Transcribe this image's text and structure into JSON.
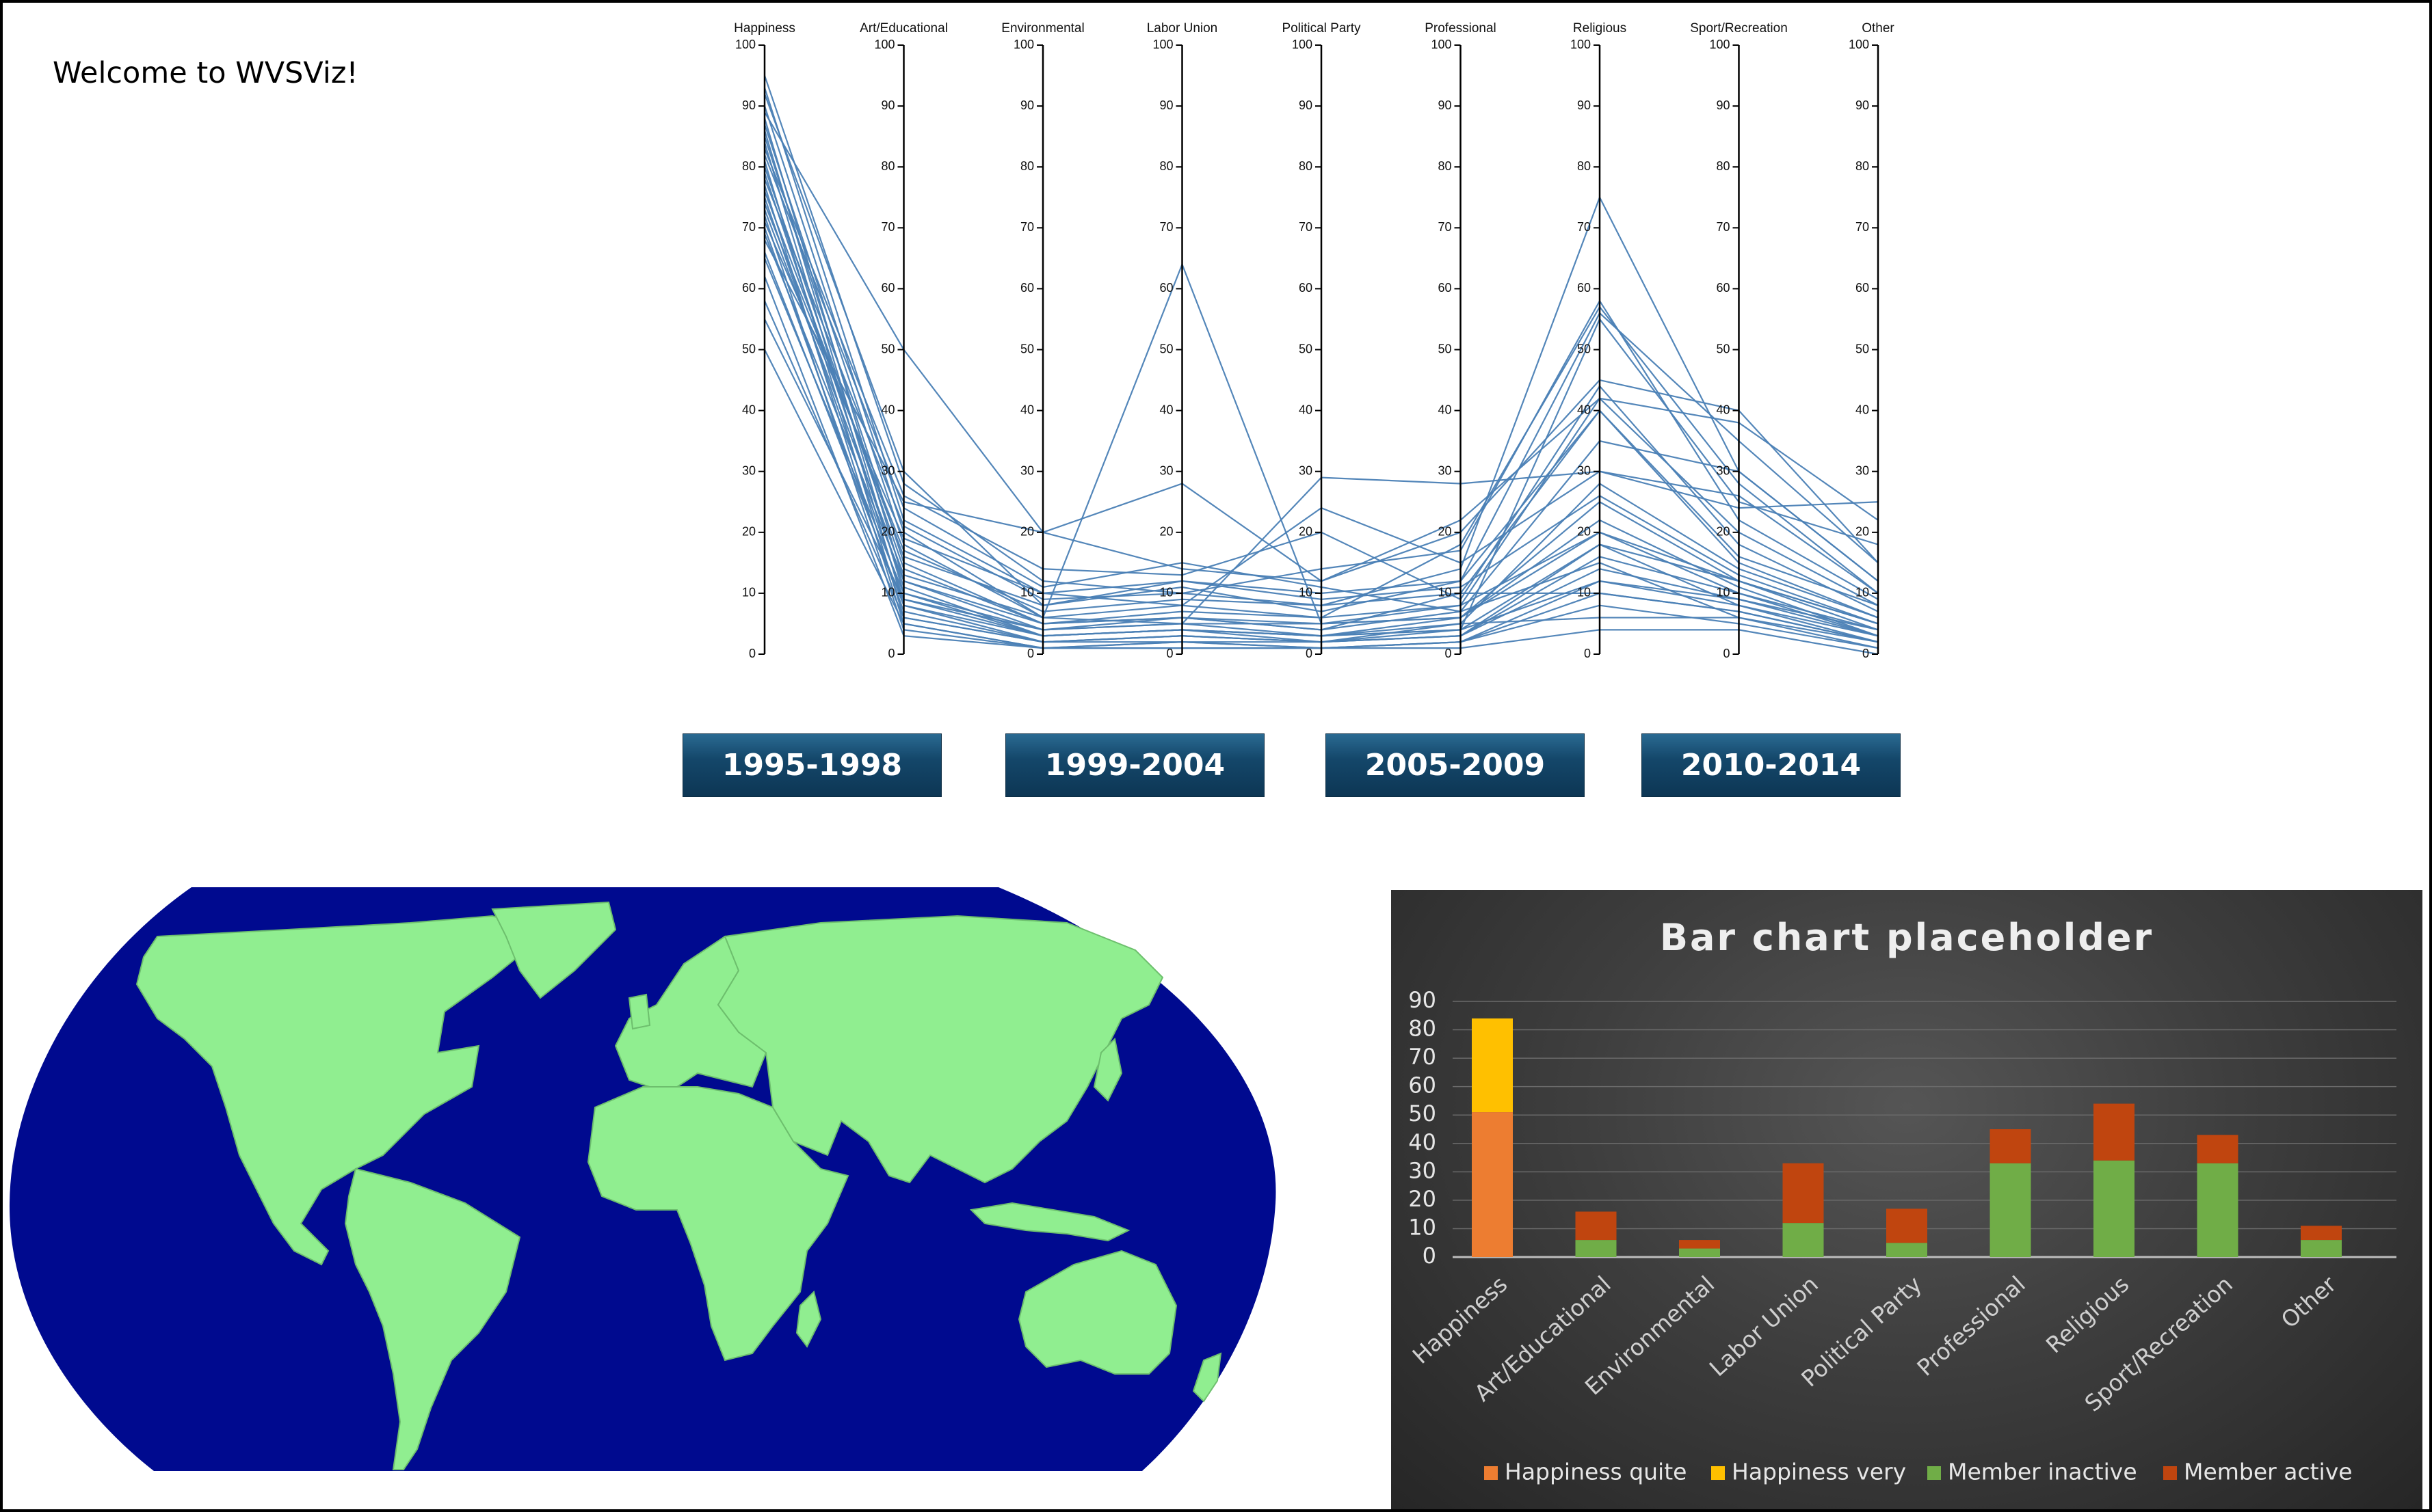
{
  "app": {
    "welcome": "Welcome to WVSViz!"
  },
  "parallel_coordinates": {
    "axes": [
      "Happiness",
      "Art/Educational",
      "Environmental",
      "Labor Union",
      "Political Party",
      "Professional",
      "Religious",
      "Sport/Recreation",
      "Other"
    ],
    "ticks": [
      0,
      10,
      20,
      30,
      40,
      50,
      60,
      70,
      80,
      90,
      100
    ],
    "line_color": "#4a7fb5",
    "records": [
      [
        95,
        28,
        12,
        10,
        8,
        14,
        75,
        30,
        12
      ],
      [
        93,
        22,
        10,
        8,
        6,
        18,
        57,
        28,
        10
      ],
      [
        92,
        30,
        8,
        12,
        10,
        12,
        56,
        35,
        15
      ],
      [
        90,
        20,
        6,
        64,
        5,
        8,
        42,
        20,
        8
      ],
      [
        89,
        50,
        20,
        28,
        12,
        22,
        42,
        38,
        22
      ],
      [
        88,
        12,
        4,
        6,
        4,
        10,
        40,
        15,
        6
      ],
      [
        87,
        18,
        6,
        5,
        29,
        28,
        30,
        24,
        25
      ],
      [
        86,
        10,
        3,
        4,
        3,
        6,
        25,
        12,
        5
      ],
      [
        85,
        15,
        5,
        7,
        6,
        8,
        20,
        10,
        4
      ],
      [
        84,
        8,
        2,
        3,
        2,
        4,
        55,
        25,
        18
      ],
      [
        83,
        26,
        14,
        13,
        20,
        9,
        44,
        18,
        7
      ],
      [
        82,
        24,
        11,
        15,
        11,
        7,
        35,
        30,
        12
      ],
      [
        81,
        6,
        2,
        2,
        2,
        3,
        18,
        8,
        3
      ],
      [
        80,
        14,
        5,
        6,
        4,
        7,
        15,
        6,
        2
      ],
      [
        79,
        11,
        3,
        4,
        3,
        5,
        28,
        14,
        6
      ],
      [
        78,
        21,
        9,
        10,
        14,
        17,
        58,
        22,
        9
      ],
      [
        77,
        5,
        1,
        2,
        1,
        2,
        12,
        9,
        4
      ],
      [
        76,
        16,
        8,
        11,
        7,
        12,
        40,
        16,
        8
      ],
      [
        75,
        9,
        4,
        5,
        5,
        6,
        22,
        11,
        3
      ],
      [
        74,
        17,
        7,
        9,
        8,
        10,
        10,
        7,
        2
      ],
      [
        73,
        13,
        6,
        8,
        24,
        15,
        30,
        26,
        10
      ],
      [
        72,
        4,
        1,
        1,
        1,
        2,
        8,
        5,
        1
      ],
      [
        71,
        19,
        10,
        12,
        9,
        11,
        26,
        13,
        5
      ],
      [
        70,
        7,
        2,
        3,
        2,
        3,
        16,
        10,
        3
      ],
      [
        69,
        12,
        5,
        6,
        5,
        6,
        20,
        12,
        4
      ],
      [
        68,
        25,
        20,
        14,
        12,
        20,
        45,
        40,
        15
      ],
      [
        66,
        8,
        3,
        4,
        2,
        5,
        6,
        6,
        1
      ],
      [
        65,
        10,
        4,
        5,
        3,
        4,
        12,
        8,
        2
      ],
      [
        62,
        3,
        1,
        1,
        1,
        1,
        4,
        4,
        0
      ],
      [
        58,
        6,
        2,
        3,
        2,
        3,
        14,
        9,
        3
      ],
      [
        55,
        9,
        3,
        4,
        3,
        4,
        18,
        12,
        5
      ],
      [
        50,
        5,
        1,
        2,
        1,
        2,
        10,
        7,
        2
      ]
    ]
  },
  "period_buttons": [
    "1995-1998",
    "1999-2004",
    "2005-2009",
    "2010-2014"
  ],
  "map": {
    "ocean_color": "#000a8f",
    "land_color": "#90ee90",
    "border_color": "#6dbf6d"
  },
  "chart_data": {
    "type": "bar",
    "title": "Bar chart placeholder",
    "categories": [
      "Happiness",
      "Art/Educational",
      "Environmental",
      "Labor Union",
      "Political Party",
      "Professional",
      "Religious",
      "Sport/Recreation",
      "Other"
    ],
    "series": [
      {
        "name": "Happiness quite",
        "color": "#ed7d31",
        "values": [
          51,
          0,
          0,
          0,
          0,
          0,
          0,
          0,
          0
        ]
      },
      {
        "name": "Happiness very",
        "color": "#ffc000",
        "values": [
          33,
          0,
          0,
          0,
          0,
          0,
          0,
          0,
          0
        ]
      },
      {
        "name": "Member inactive",
        "color": "#70ad47",
        "values": [
          0,
          6,
          3,
          12,
          5,
          33,
          34,
          33,
          6
        ]
      },
      {
        "name": "Member active",
        "color": "#c0450f",
        "values": [
          0,
          10,
          3,
          21,
          12,
          12,
          20,
          10,
          5
        ]
      }
    ],
    "stacked": true,
    "ylim": [
      0,
      90
    ],
    "yticks": [
      0,
      10,
      20,
      30,
      40,
      50,
      60,
      70,
      80,
      90
    ],
    "legend_position": "bottom",
    "grid": true
  }
}
